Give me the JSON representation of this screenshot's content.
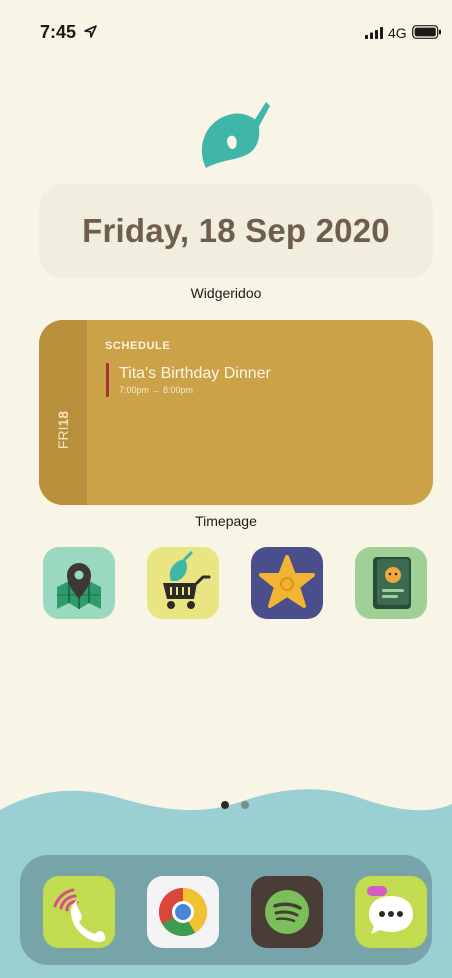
{
  "status_bar": {
    "time": "7:45",
    "network": "4G",
    "icons": [
      "location-arrow-icon",
      "signal-bars-icon",
      "battery-icon"
    ]
  },
  "logo": {
    "icon": "leaf-icon",
    "color": "#3fb6a8"
  },
  "date_widget": {
    "date_text": "Friday, 18 Sep 2020",
    "app_label": "Widgeridoo"
  },
  "schedule_widget": {
    "day_name": "FRI",
    "day_number": "18",
    "heading": "SCHEDULE",
    "event": {
      "title": "Tita's Birthday Dinner",
      "time": "7:00pm → 8:00pm",
      "color": "#a33232"
    },
    "app_label": "Timepage",
    "colors": {
      "background": "#cca248",
      "sidebar": "#b88f3a"
    }
  },
  "apps": [
    {
      "icon": "map-pin-icon",
      "background": "#9ad8bf"
    },
    {
      "icon": "shopping-cart-icon",
      "background": "#e9e582"
    },
    {
      "icon": "star-icon",
      "background": "#4a4f8c"
    },
    {
      "icon": "passport-icon",
      "background": "#9fd095"
    }
  ],
  "page_indicator": {
    "pages": 2,
    "current": 1
  },
  "dock": [
    {
      "icon": "phone-icon",
      "background": "#c1dc4f"
    },
    {
      "icon": "chrome-icon",
      "background": "#f4f4f4"
    },
    {
      "icon": "spotify-icon",
      "background": "#4a3d37"
    },
    {
      "icon": "messages-icon",
      "background": "#c1dc4f"
    }
  ],
  "colors": {
    "screen_background": "#f8f4e6",
    "wave": "#9acfd4",
    "dock": "#77a4a8"
  }
}
